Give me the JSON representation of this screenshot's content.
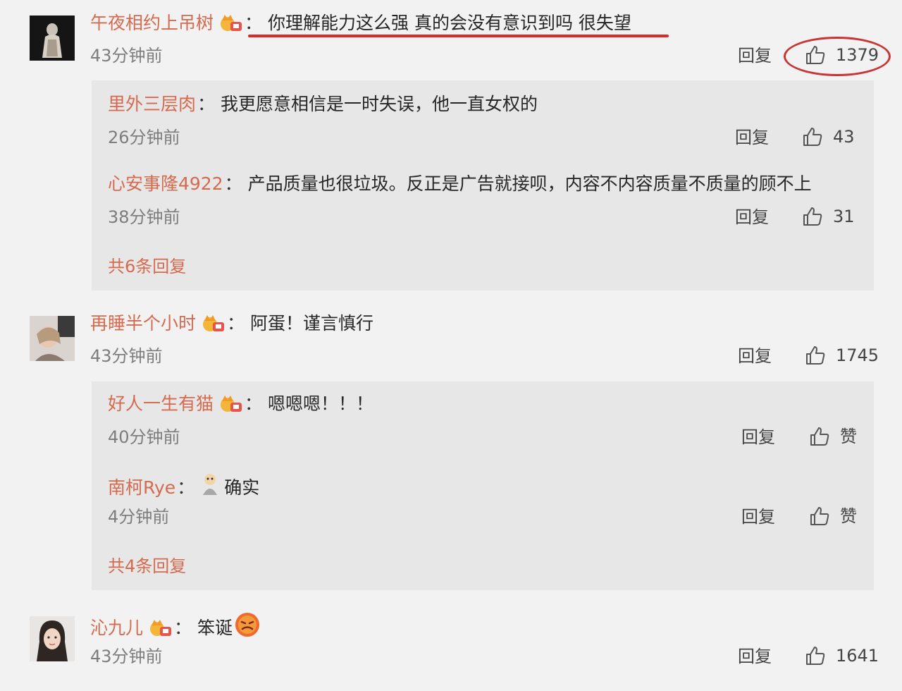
{
  "comments": [
    {
      "username": "午夜相约上吊树",
      "text": "你理解能力这么强 真的会没有意识到吗 很失望",
      "time": "43分钟前",
      "reply_label": "回复",
      "likes": "1379",
      "replies": [
        {
          "username": "里外三层肉",
          "text": "我更愿意相信是一时失误，他一直女权的",
          "time": "26分钟前",
          "reply_label": "回复",
          "likes": "43"
        },
        {
          "username": "心安事隆4922",
          "text": "产品质量也很垃圾。反正是广告就接呗，内容不内容质量不质量的顾不上",
          "time": "38分钟前",
          "reply_label": "回复",
          "likes": "31"
        }
      ],
      "more_replies": "共6条回复"
    },
    {
      "username": "再睡半个小时",
      "text": "阿蛋！谨言慎行",
      "time": "43分钟前",
      "reply_label": "回复",
      "likes": "1745",
      "replies": [
        {
          "username": "好人一生有猫",
          "text": "嗯嗯嗯！！！",
          "time": "40分钟前",
          "reply_label": "回复",
          "likes": "赞"
        },
        {
          "username": "南柯Rye",
          "text": "确实",
          "time": "4分钟前",
          "reply_label": "回复",
          "likes": "赞"
        }
      ],
      "more_replies": "共4条回复"
    },
    {
      "username": "沁九儿",
      "text": "笨诞",
      "time": "43分钟前",
      "reply_label": "回复",
      "likes": "1641"
    }
  ],
  "colors": {
    "username": "#d66a4e",
    "highlight_red": "#d72b2b",
    "background": "#f2f2f2",
    "reply_box": "#e7e7e7"
  },
  "icons": [
    "thumbs-up-icon",
    "vip-crown-icon",
    "emoji-icon"
  ]
}
